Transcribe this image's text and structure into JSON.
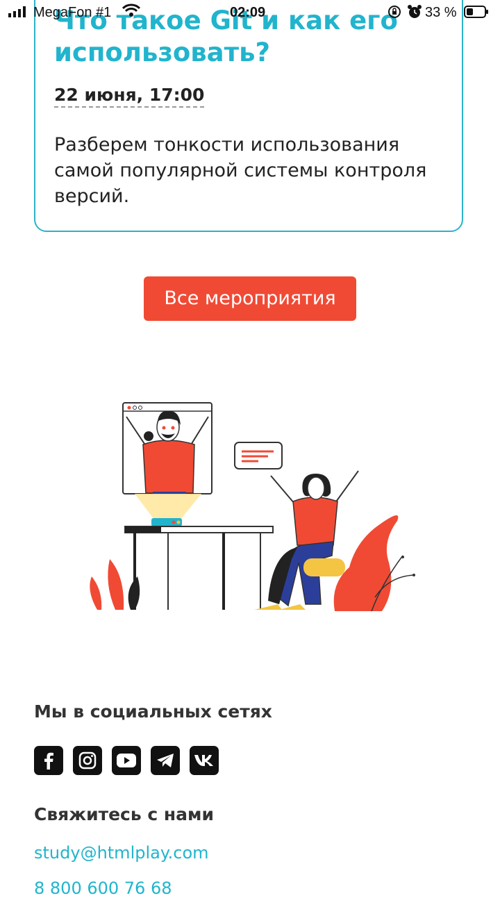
{
  "status_bar": {
    "carrier": "MegaFon #1",
    "time": "02:09",
    "battery": "33 %"
  },
  "event_card": {
    "title": "Что такое Git и как его использовать?",
    "date": "22 июня, 17:00",
    "description": "Разберем тонкости использования самой популярной системы контроля версий."
  },
  "cta": {
    "label": "Все мероприятия"
  },
  "colors": {
    "accent": "#21b4cd",
    "button": "#f04a35"
  },
  "footer": {
    "social_heading": "Мы в социальных сетях",
    "social_icons": [
      "facebook-icon",
      "instagram-icon",
      "youtube-icon",
      "telegram-icon",
      "vk-icon"
    ],
    "contact_heading": "Свяжитесь с нами",
    "email": "study@htmlplay.com",
    "phone": "8 800 600 76 68"
  }
}
